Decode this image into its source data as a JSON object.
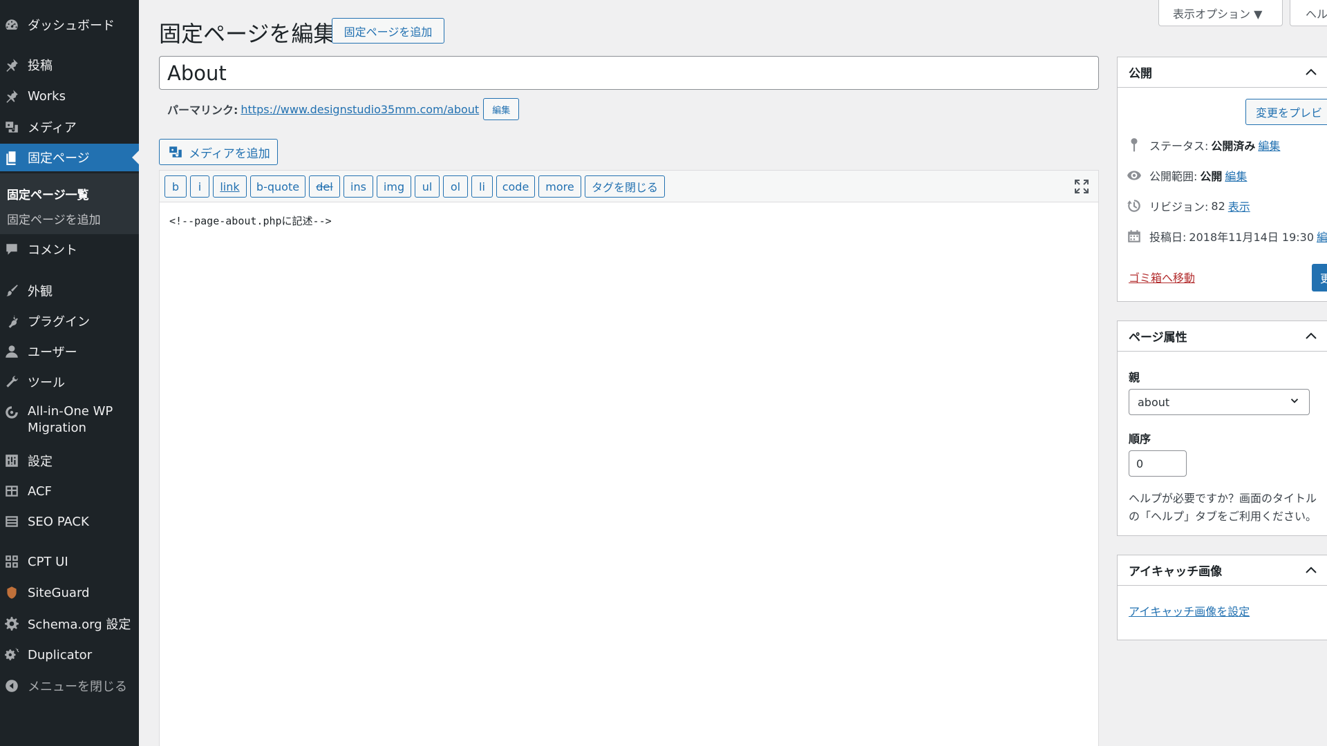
{
  "sidebar": {
    "items": [
      {
        "label": "ダッシュボード",
        "icon": "dashboard-icon"
      },
      {
        "label": "投稿",
        "icon": "pin-icon"
      },
      {
        "label": "Works",
        "icon": "pin-icon"
      },
      {
        "label": "メディア",
        "icon": "media-icon"
      },
      {
        "label": "固定ページ",
        "icon": "page-icon"
      },
      {
        "label": "コメント",
        "icon": "comment-icon"
      },
      {
        "label": "外観",
        "icon": "brush-icon"
      },
      {
        "label": "プラグイン",
        "icon": "plugin-icon"
      },
      {
        "label": "ユーザー",
        "icon": "user-icon"
      },
      {
        "label": "ツール",
        "icon": "wrench-icon"
      },
      {
        "label": "All-in-One WP",
        "label2": "Migration",
        "icon": "migration-icon"
      },
      {
        "label": "設定",
        "icon": "settings-icon"
      },
      {
        "label": "ACF",
        "icon": "table-icon"
      },
      {
        "label": "SEO PACK",
        "icon": "list-icon"
      },
      {
        "label": "CPT UI",
        "icon": "grid-icon"
      },
      {
        "label": "SiteGuard",
        "icon": "shield-icon"
      },
      {
        "label": "Schema.org 設定",
        "icon": "gear-icon"
      },
      {
        "label": "Duplicator",
        "icon": "gears-icon"
      }
    ],
    "submenu": [
      "固定ページ一覧",
      "固定ページを追加"
    ],
    "collapse_label": "メニューを閉じる"
  },
  "screen_meta": {
    "options_label": "表示オプション ▼",
    "help_label": "ヘル"
  },
  "header": {
    "title": "固定ページを編集",
    "add_new_label": "固定ページを追加"
  },
  "post": {
    "title": "About",
    "permalink_label": "パーマリンク:",
    "permalink_url": "https://www.designstudio35mm.com/about",
    "permalink_edit_label": "編集"
  },
  "editor": {
    "add_media_label": "メディアを追加",
    "buttons": [
      "b",
      "i",
      "link",
      "b-quote",
      "del",
      "ins",
      "img",
      "ul",
      "ol",
      "li",
      "code",
      "more",
      "タグを閉じる"
    ],
    "content": "<!--page-about.phpに記述-->"
  },
  "publish_box": {
    "title": "公開",
    "preview_label": "変更をプレビ",
    "status_label": "ステータス:",
    "status_value": "公開済み",
    "status_edit": "編集",
    "visibility_label": "公開範囲:",
    "visibility_value": "公開",
    "visibility_edit": "編集",
    "revisions_label": "リビジョン:",
    "revisions_value": "82",
    "revisions_link": "表示",
    "date_label": "投稿日:",
    "date_value": "2018年11月14日 19:30",
    "date_edit": "編集",
    "trash_label": "ゴミ箱へ移動",
    "update_label": "更"
  },
  "attributes_box": {
    "title": "ページ属性",
    "parent_label": "親",
    "parent_value": "about",
    "order_label": "順序",
    "order_value": "0",
    "help_line1": "ヘルプが必要ですか？画面のタイトル",
    "help_line2": "の「ヘルプ」タブをご利用ください。"
  },
  "thumbnail_box": {
    "title": "アイキャッチ画像",
    "set_label": "アイキャッチ画像を設定"
  },
  "colors": {
    "sidebar_bg": "#1d2327",
    "accent": "#2271b1",
    "trash": "#b32d2e"
  }
}
